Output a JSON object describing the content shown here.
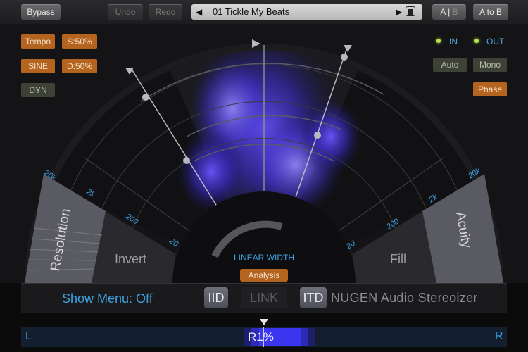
{
  "toolbar": {
    "bypass": "Bypass",
    "undo": "Undo",
    "redo": "Redo",
    "preset_name": "01 Tickle My Beats",
    "ab_a": "A",
    "ab_sep": "|",
    "ab_b": "B",
    "a_to_b": "A to B"
  },
  "left_controls": {
    "tempo": "Tempo",
    "sync": "S:50%",
    "sine": "SINE",
    "depth": "D:50%",
    "dyn": "DYN"
  },
  "right_controls": {
    "in_label": "IN",
    "out_label": "OUT",
    "auto": "Auto",
    "mono": "Mono",
    "phase": "Phase"
  },
  "display": {
    "left_ticks": [
      "20k",
      "2k",
      "200",
      "20"
    ],
    "right_ticks": [
      "20k",
      "2k",
      "200",
      "20"
    ],
    "resolution": "Resolution",
    "invert": "Invert",
    "fill": "Fill",
    "acuity": "Acuity",
    "linear_width": "LINEAR WIDTH",
    "analysis": "Analysis"
  },
  "bottom": {
    "show_menu": "Show Menu: Off",
    "iid": "IID",
    "link": "LINK",
    "itd": "ITD",
    "brand": "NUGEN Audio Stereoizer"
  },
  "balance": {
    "left": "L",
    "right": "R",
    "value": "R1%"
  },
  "colors": {
    "accent_blue": "#3ea0e0",
    "orange_button": "#b5641f",
    "led_green": "#b9e34a",
    "spectral_blue": "#3a2cff"
  }
}
